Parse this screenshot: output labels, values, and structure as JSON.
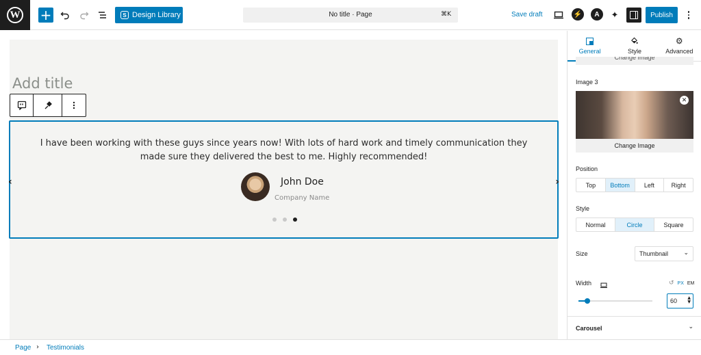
{
  "topbar": {
    "design_library": "Design Library",
    "doc_title": "No title · Page",
    "shortcut": "⌘K",
    "save_draft": "Save draft",
    "publish": "Publish"
  },
  "editor": {
    "title_placeholder": "Add title",
    "testimonial": {
      "quote": "I have been working with these guys since years now! With lots of hard work and timely communication they made sure they delivered the best to me. Highly recommended!",
      "name": "John Doe",
      "company": "Company Name",
      "dots_total": 3,
      "dots_active": 3
    }
  },
  "sidebar": {
    "tabs": [
      {
        "label": "General",
        "icon": "layout-icon"
      },
      {
        "label": "Style",
        "icon": "paint-bucket-icon"
      },
      {
        "label": "Advanced",
        "icon": "gear-icon"
      }
    ],
    "clipped_prev": "Change Image",
    "image3_label": "Image 3",
    "change_image": "Change Image",
    "position_label": "Position",
    "position_options": [
      "Top",
      "Bottom",
      "Left",
      "Right"
    ],
    "position_selected": "Bottom",
    "style_label": "Style",
    "style_options": [
      "Normal",
      "Circle",
      "Square"
    ],
    "style_selected": "Circle",
    "size_label": "Size",
    "size_value": "Thumbnail",
    "width_label": "Width",
    "units": [
      "PX",
      "EM"
    ],
    "unit_selected": "PX",
    "width_value": "60",
    "slider_fraction": 0.12,
    "carousel_label": "Carousel"
  },
  "footer": {
    "crumb_page": "Page",
    "crumb_block": "Testimonials"
  },
  "colors": {
    "accent": "#007cba",
    "dark": "#1e1e1e"
  }
}
